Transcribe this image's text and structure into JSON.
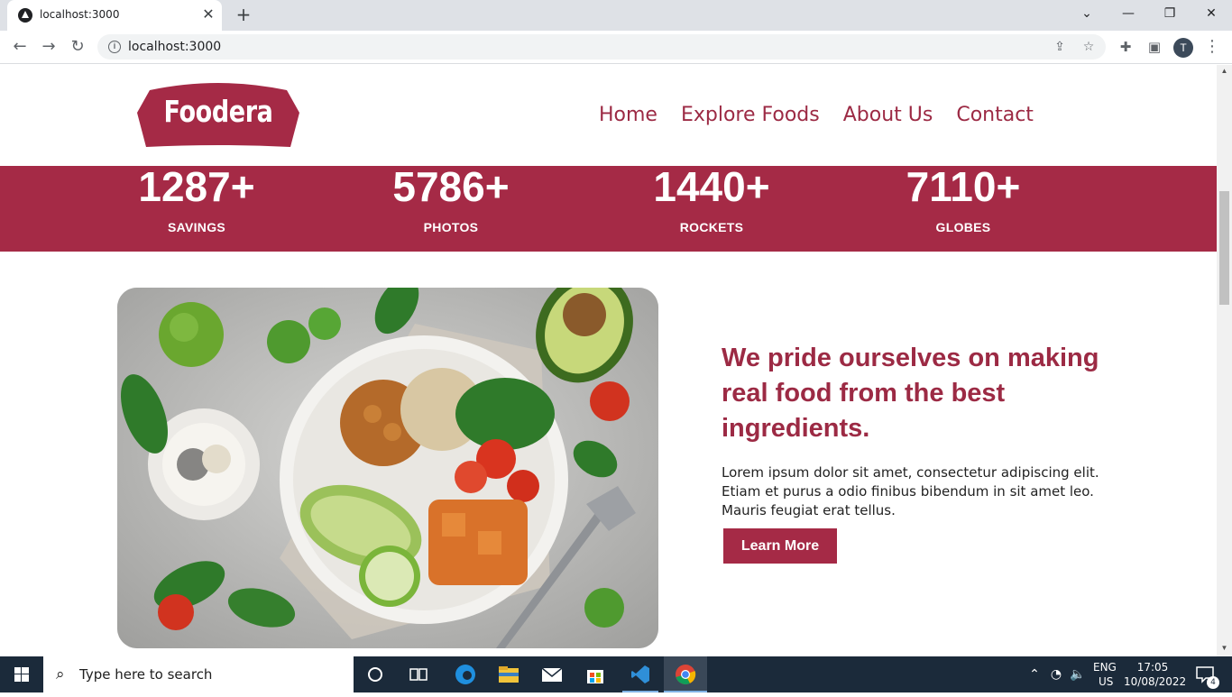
{
  "browser": {
    "tab_title": "localhost:3000",
    "url": "localhost:3000",
    "profile_initial": "T"
  },
  "site": {
    "brand": "Foodera",
    "nav": [
      "Home",
      "Explore Foods",
      "About Us",
      "Contact"
    ],
    "accent_color": "#a52a46"
  },
  "stats": [
    {
      "value": "1287+",
      "label": "SAVINGS"
    },
    {
      "value": "5786+",
      "label": "PHOTOS"
    },
    {
      "value": "1440+",
      "label": "ROCKETS"
    },
    {
      "value": "7110+",
      "label": "GLOBES"
    }
  ],
  "about": {
    "heading": "We pride ourselves on making real food from the best ingredients.",
    "body": "Lorem ipsum dolor sit amet, consectetur adipiscing elit. Etiam et purus a odio finibus bibendum in sit amet leo. Mauris feugiat erat tellus.",
    "button_label": "Learn More"
  },
  "taskbar": {
    "search_placeholder": "Type here to search",
    "lang_top": "ENG",
    "lang_bottom": "US",
    "time": "17:05",
    "date": "10/08/2022",
    "notifications": "4"
  }
}
